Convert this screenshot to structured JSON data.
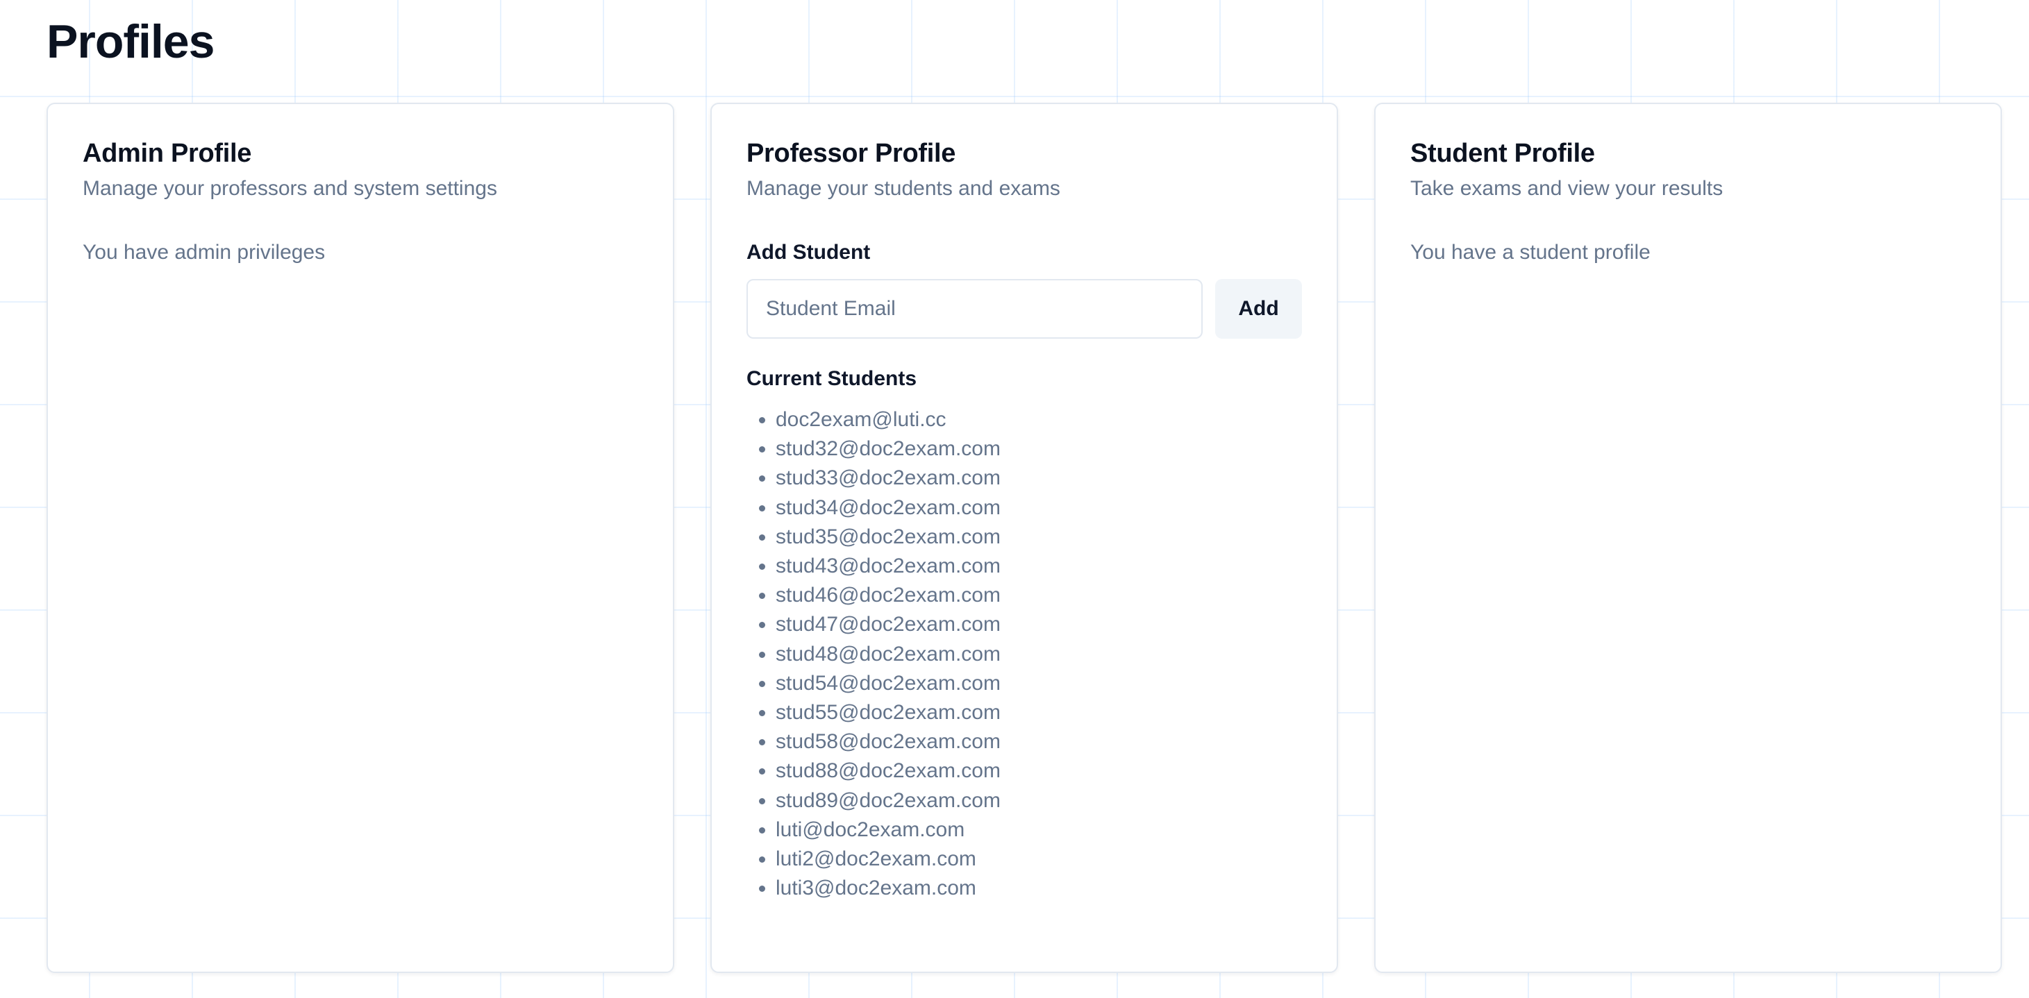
{
  "page": {
    "title": "Profiles"
  },
  "admin": {
    "title": "Admin Profile",
    "subtitle": "Manage your professors and system settings",
    "status": "You have admin privileges"
  },
  "professor": {
    "title": "Professor Profile",
    "subtitle": "Manage your students and exams",
    "add_student_label": "Add Student",
    "email_placeholder": "Student Email",
    "email_value": "",
    "add_button_label": "Add",
    "current_students_label": "Current Students",
    "students": [
      "doc2exam@luti.cc",
      "stud32@doc2exam.com",
      "stud33@doc2exam.com",
      "stud34@doc2exam.com",
      "stud35@doc2exam.com",
      "stud43@doc2exam.com",
      "stud46@doc2exam.com",
      "stud47@doc2exam.com",
      "stud48@doc2exam.com",
      "stud54@doc2exam.com",
      "stud55@doc2exam.com",
      "stud58@doc2exam.com",
      "stud88@doc2exam.com",
      "stud89@doc2exam.com",
      "luti@doc2exam.com",
      "luti2@doc2exam.com",
      "luti3@doc2exam.com"
    ]
  },
  "student": {
    "title": "Student Profile",
    "subtitle": "Take exams and view your results",
    "status": "You have a student profile"
  },
  "colors": {
    "title_text": "#0b1220",
    "muted_text": "#64748b",
    "card_border": "#e2e8f0",
    "button_bg": "#f1f5f9",
    "grid_line": "#93c5fd"
  }
}
